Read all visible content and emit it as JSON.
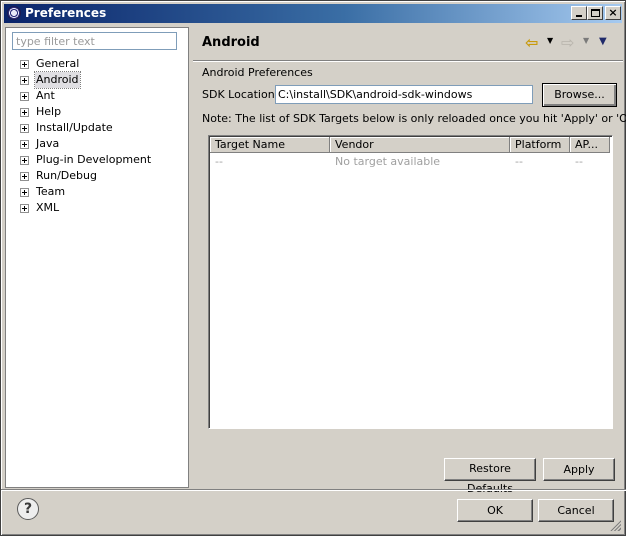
{
  "window": {
    "title": "Preferences",
    "controls": {
      "minimize_icon": "minimize-icon",
      "maximize_icon": "maximize-icon",
      "close_icon": "close-icon",
      "close_glyph": "×"
    }
  },
  "left": {
    "filter_placeholder": "type filter text",
    "tree": [
      {
        "label": "General",
        "selected": false
      },
      {
        "label": "Android",
        "selected": true
      },
      {
        "label": "Ant",
        "selected": false
      },
      {
        "label": "Help",
        "selected": false
      },
      {
        "label": "Install/Update",
        "selected": false
      },
      {
        "label": "Java",
        "selected": false
      },
      {
        "label": "Plug-in Development",
        "selected": false
      },
      {
        "label": "Run/Debug",
        "selected": false
      },
      {
        "label": "Team",
        "selected": false
      },
      {
        "label": "XML",
        "selected": false
      }
    ]
  },
  "page": {
    "title": "Android",
    "nav": {
      "back_glyph": "⇦",
      "forward_glyph": "⇨",
      "dropdown_glyph": "▼"
    },
    "section_label": "Android Preferences",
    "sdk_label": "SDK Location:",
    "sdk_value": "C:\\install\\SDK\\android-sdk-windows",
    "browse_label": "Browse...",
    "note": "Note: The list of SDK Targets below is only reloaded once you hit 'Apply' or 'OK'.",
    "table": {
      "columns": [
        "Target Name",
        "Vendor",
        "Platform",
        "AP..."
      ],
      "rows": [
        {
          "name": "--",
          "vendor": "No target available",
          "platform": "--",
          "api": "--"
        }
      ]
    },
    "restore_defaults_label": "Restore Defaults",
    "apply_label": "Apply"
  },
  "footer": {
    "help_glyph": "?",
    "ok_label": "OK",
    "cancel_label": "Cancel"
  },
  "colors": {
    "titlebar_start": "#0a246a",
    "titlebar_end": "#a6caf0",
    "dialog_bg": "#d4d0c8",
    "nav_back_icon": "#c89a0c"
  }
}
